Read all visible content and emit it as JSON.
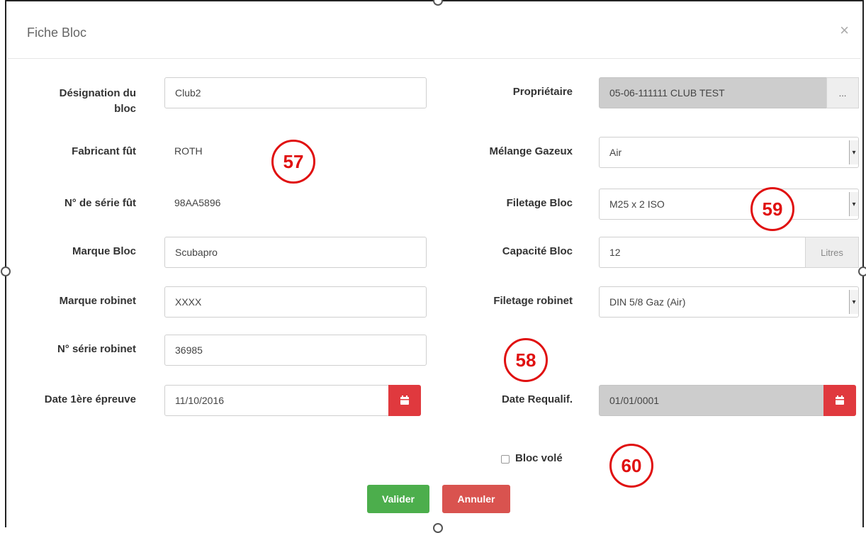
{
  "modal": {
    "title": "Fiche Bloc",
    "close_glyph": "×"
  },
  "left": {
    "designation": {
      "label_line1": "Désignation du",
      "label_line2": "bloc",
      "value": "Club2"
    },
    "fabricant": {
      "label": "Fabricant fût",
      "value": "ROTH"
    },
    "serie_fut": {
      "label": "N° de série fût",
      "value": "98AA5896"
    },
    "marque_bloc": {
      "label": "Marque Bloc",
      "value": "Scubapro"
    },
    "marque_robinet": {
      "label": "Marque robinet",
      "value": "XXXX"
    },
    "serie_robinet": {
      "label": "N° série robinet",
      "value": "36985"
    },
    "date_epreuve": {
      "label": "Date 1ère épreuve",
      "value": "11/10/2016"
    }
  },
  "right": {
    "proprietaire": {
      "label": "Propriétaire",
      "value": "05-06-111111 CLUB TEST",
      "button": "..."
    },
    "melange": {
      "label": "Mélange Gazeux",
      "value": "Air"
    },
    "filetage_bloc": {
      "label": "Filetage Bloc",
      "value": "M25 x 2 ISO"
    },
    "capacite": {
      "label": "Capacité Bloc",
      "value": "12",
      "unit": "Litres"
    },
    "filetage_robinet": {
      "label": "Filetage robinet",
      "value": "DIN 5/8 Gaz (Air)"
    },
    "date_requalif": {
      "label": "Date Requalif.",
      "value": "01/01/0001"
    },
    "bloc_vole": {
      "label": "Bloc volé",
      "checked": false
    }
  },
  "buttons": {
    "valider": "Valider",
    "annuler": "Annuler"
  },
  "annotations": {
    "a57": "57",
    "a58": "58",
    "a59": "59",
    "a60": "60"
  },
  "colors": {
    "accent_red": "#e0393e",
    "valider_green": "#4cae4c",
    "annuler_red": "#d9534f",
    "annotation_red": "#e01010"
  },
  "icons": {
    "calendar": "calendar-icon",
    "select_arrow": "chevron-down-icon"
  }
}
